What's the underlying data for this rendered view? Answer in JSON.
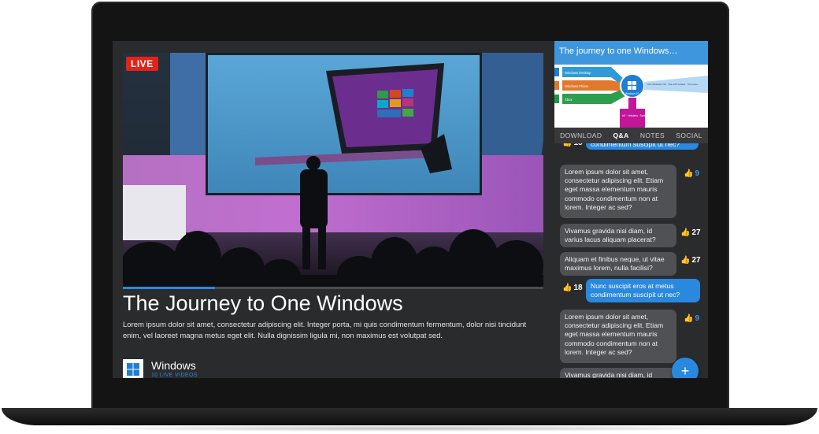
{
  "video": {
    "live_badge": "LIVE",
    "progress": 0.22,
    "title": "The Journey to One Windows",
    "description": "Lorem ipsum dolor sit amet, consectetur adipiscing elit. Integer porta, mi quis condimentum fermentum, dolor nisi tincidunt enim, vel laoreet magna metus eget elit. Nulla dignissim ligula mi, non maximus est volutpat sed."
  },
  "channel": {
    "name": "Windows",
    "subtitle": "10 LIVE VIDEOS"
  },
  "slide": {
    "title": "The journey to one Windows…",
    "rows": [
      "Windows Desktop",
      "Windows Phone",
      "Xbox"
    ],
    "center_label": "Windows 10",
    "right_note": "One Windows OS · One API surface · One store",
    "bottom_note": "IoT · Hololens · Surface Hub"
  },
  "tabs": [
    {
      "label": "DOWNLOAD",
      "active": false
    },
    {
      "label": "Q&A",
      "active": true
    },
    {
      "label": "NOTES",
      "active": false
    },
    {
      "label": "SOCIAL",
      "active": false
    }
  ],
  "chat": {
    "top_partial": {
      "likes": "18",
      "text": "condimentum suscipit ut nec?"
    },
    "messages": [
      {
        "type": "in",
        "text": "Lorem ipsum dolor sit amet, consectetur adipiscing elit. Etiam eget massa elementum mauris commodo condimentum non at lorem. Integer ac sed?",
        "likes": "9"
      },
      {
        "type": "in",
        "text": "Vivamus gravida nisi diam, id varius lacus aliquam placerat?",
        "likes": "27"
      },
      {
        "type": "in",
        "text": "Aliquam et finibus neque, ut vitae maximus lorem, nulla facilisi?",
        "likes": "27"
      },
      {
        "type": "out",
        "text": "Nunc suscipit eros at metus condimentum suscipit ut nec?",
        "likes": "18"
      },
      {
        "type": "in",
        "text": "Lorem ipsum dolor sit amet, consectetur adipiscing elit. Etiam eget massa elementum mauris commodo condimentum non at lorem. Integer ac sed?",
        "likes": "9"
      },
      {
        "type": "in",
        "text": "Vivamus gravida nisi diam, id",
        "likes": ""
      }
    ],
    "fab_label": "+"
  },
  "colors": {
    "accent": "#2a88de",
    "live": "#e2231a",
    "screen_bg": "#2a2b2d"
  }
}
